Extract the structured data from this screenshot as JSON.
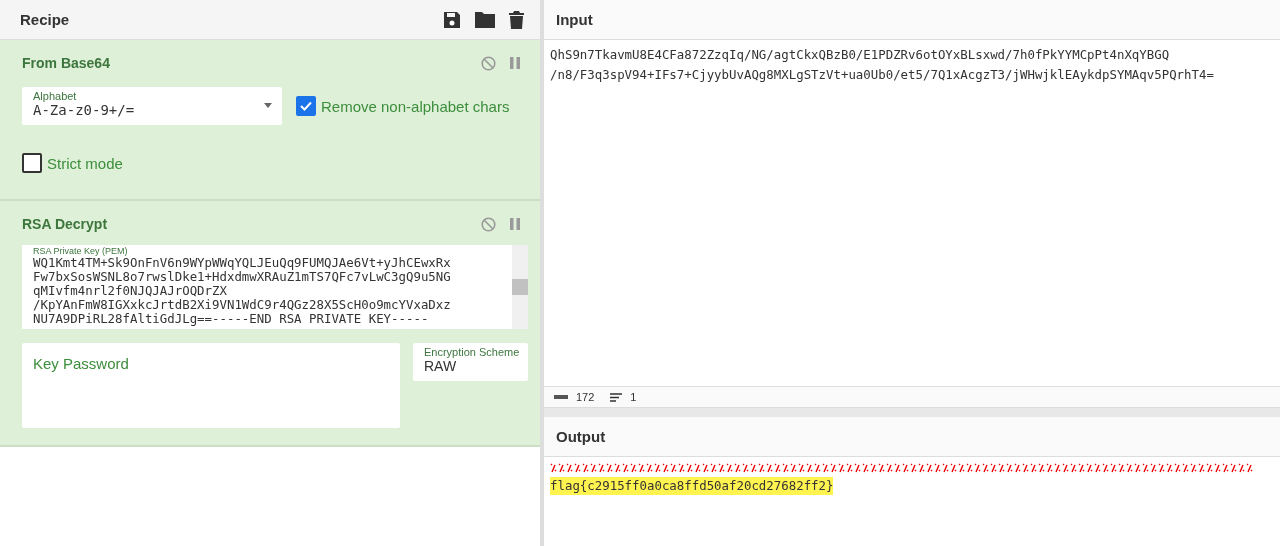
{
  "recipe": {
    "title": "Recipe",
    "operations": [
      {
        "kind": "from_base64",
        "name": "From Base64",
        "alphabet": {
          "label": "Alphabet",
          "value": "A-Za-z0-9+/="
        },
        "remove_non_alphabet": {
          "label": "Remove non-alphabet chars",
          "checked": true
        },
        "strict_mode": {
          "label": "Strict mode",
          "checked": false
        }
      },
      {
        "kind": "rsa_decrypt",
        "name": "RSA Decrypt",
        "private_key": {
          "label": "RSA Private Key (PEM)",
          "lines": [
            "WQ1Kmt4TM+Sk9OnFnV6n9WYpWWqYQLJEuQq9FUMQJAe6Vt+yJhCEwxRx",
            "Fw7bxSosWSNL8o7rwslDke1+HdxdmwXRAuZ1mTS7QFc7vLwC3gQ9u5NG",
            "qMIvfm4nrl2f0NJQJAJrOQDrZX",
            "/KpYAnFmW8IGXxkcJrtdB2Xi9VN1WdC9r4QGz28X5ScH0o9mcYVxaDxz",
            "NU7A9DPiRL28fAltiGdJLg==-----END RSA PRIVATE KEY-----"
          ]
        },
        "key_password": {
          "placeholder": "Key Password"
        },
        "encryption_scheme": {
          "label": "Encryption Scheme",
          "value": "RAW"
        }
      }
    ]
  },
  "input": {
    "title": "Input",
    "lines": [
      "QhS9n7TkavmU8E4CFa872ZzqIq/NG/agtCkxQBzB0/E1PDZRv6otOYxBLsxwd/7h0fPkYYMCpPt4nXqYBGQ",
      "/n8/F3q3spV94+IFs7+CjyybUvAQg8MXLgSTzVt+ua0Ub0/et5/7Q1xAcgzT3/jWHwjklEAykdpSYMAqv5PQrhT4="
    ],
    "stats": {
      "length": "172",
      "lines": "1"
    }
  },
  "output": {
    "title": "Output",
    "lines": [
      "flag{c2915ff0a0ca8ffd50af20cd27682ff2}"
    ]
  }
}
